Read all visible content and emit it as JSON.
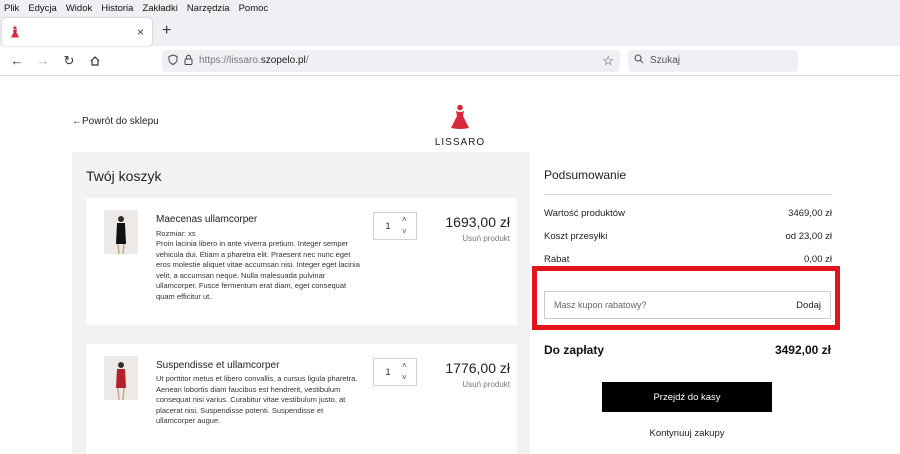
{
  "menu": [
    "Plik",
    "Edycja",
    "Widok",
    "Historia",
    "Zakładki",
    "Narzędzia",
    "Pomoc"
  ],
  "tab": {
    "close": "×",
    "new": "+"
  },
  "url": {
    "prefix": "https://lissaro.",
    "domain": "szopelo.pl",
    "suffix": "/"
  },
  "search": {
    "placeholder": "Szukaj"
  },
  "page": {
    "back_link": "←Powrót do sklepu",
    "logo_text": "LISSARO",
    "cart_title": "Twój koszyk",
    "items": [
      {
        "name": "Maecenas ullamcorper",
        "size_label": "Rozmiar: xs",
        "description": "Proin lacinia libero in ante viverra pretium. Integer semper vehicula dui. Etiam a pharetra elit. Praesent nec nunc eget eros molestie aliquet vitae accumsan nisi. Integer eget lacinia velit, a accumsan neque. Nulla malesuada pulvinar ullamcorper. Fusce fermentum erat diam, eget consequat quam efficitur ut.",
        "qty": "1",
        "price": "1693,00 zł",
        "remove": "Usuń produkt"
      },
      {
        "name": "Suspendisse et ullamcorper",
        "description": "Ut porttitor metus et libero convallis, a cursus ligula pharetra. Aenean lobortis diam faucibus est hendrerit, vestibulum consequat nisi varius. Curabitur vitae vestibulum justo, at placerat nisi. Suspendisse potenti. Suspendisse et ullamcorper augue.",
        "qty": "1",
        "price": "1776,00 zł",
        "remove": "Usuń produkt"
      }
    ],
    "summary": {
      "title": "Podsumowanie",
      "rows": [
        {
          "label": "Wartość produktów",
          "value": "3469,00 zł"
        },
        {
          "label": "Koszt przesyłki",
          "value": "od 23,00 zł"
        },
        {
          "label": "Rabat",
          "value": "0,00 zł"
        }
      ],
      "coupon_placeholder": "Masz kupon rabatowy?",
      "coupon_button": "Dodaj",
      "total_label": "Do zapłaty",
      "total_value": "3492,00 zł",
      "checkout_button": "Przejdź do kasy",
      "continue_link": "Kontynuuj zakupy"
    }
  },
  "colors": {
    "highlight": "#e4141b",
    "brand": "#d8283a",
    "checkout_bg": "#000000"
  }
}
